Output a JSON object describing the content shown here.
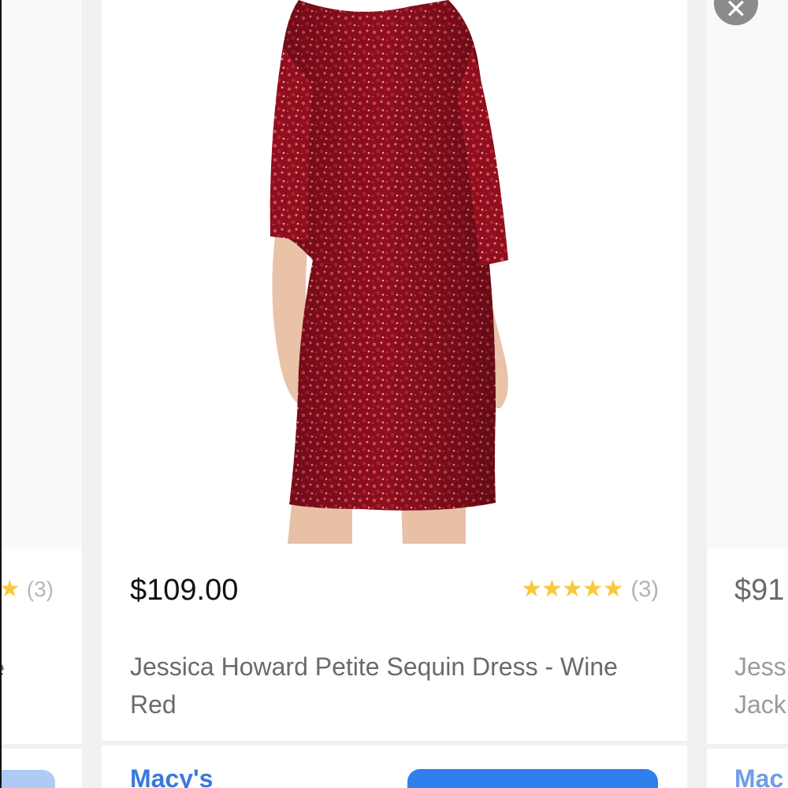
{
  "previous_card": {
    "rating_count": "(3)",
    "title_fragment": "e"
  },
  "main_card": {
    "price": "$109.00",
    "rating": {
      "stars": "★★★★★",
      "count": "(3)",
      "value": 5,
      "max": 5
    },
    "title": "Jessica Howard Petite Sequin Dress - Wine Red",
    "store": "Macy's",
    "image_alt": "Wine red sequin dress"
  },
  "next_card": {
    "price": "$91",
    "title_fragment": "Jess\nJack",
    "store_fragment": "Mac"
  },
  "close": {
    "label": "✕"
  },
  "colors": {
    "accent_blue": "#2f80ed",
    "store_link": "#3a78df",
    "star_gold": "#f8c93a",
    "dress_red": "#8e0f1e"
  }
}
